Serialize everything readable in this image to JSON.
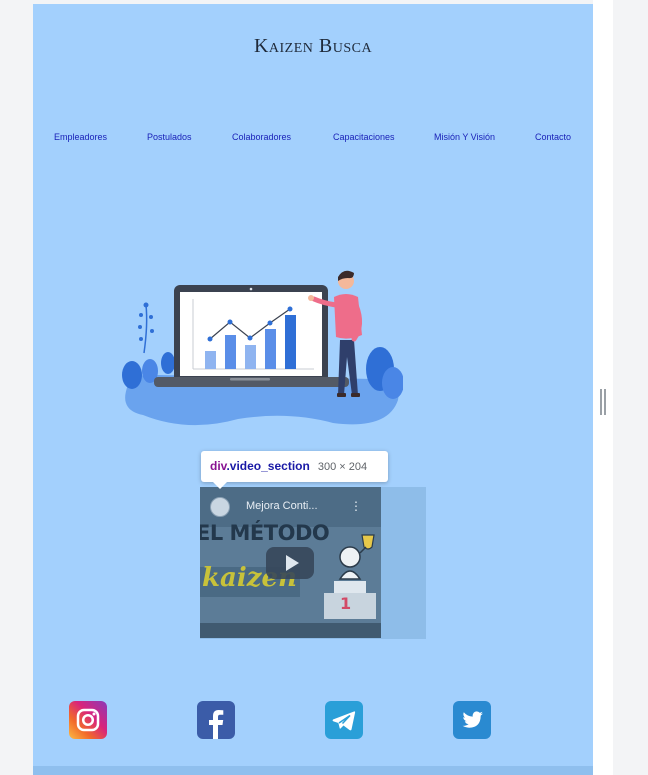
{
  "site": {
    "title": "Kaizen Busca"
  },
  "nav": {
    "items": [
      {
        "label": "Empleadores"
      },
      {
        "label": "Postulados"
      },
      {
        "label": "Colaboradores"
      },
      {
        "label": "Capacitaciones"
      },
      {
        "label": "Misión Y Visión"
      },
      {
        "label": "Contacto"
      }
    ]
  },
  "hero": {
    "illustration": "analytics-presentation"
  },
  "video": {
    "title": "Mejora Conti...",
    "thumbnail_heading": "EL MÉTODO",
    "thumbnail_word": "kaizen"
  },
  "devtools": {
    "tooltip": {
      "tag": "div",
      "class": ".video_section",
      "dims": "300 × 204"
    }
  },
  "social": {
    "icons": [
      "instagram-icon",
      "facebook-icon",
      "telegram-icon",
      "twitter-icon"
    ]
  },
  "colors": {
    "page_bg": "#a3d0fd",
    "nav_link": "#1a22b8",
    "title": "#1f2a3a"
  }
}
